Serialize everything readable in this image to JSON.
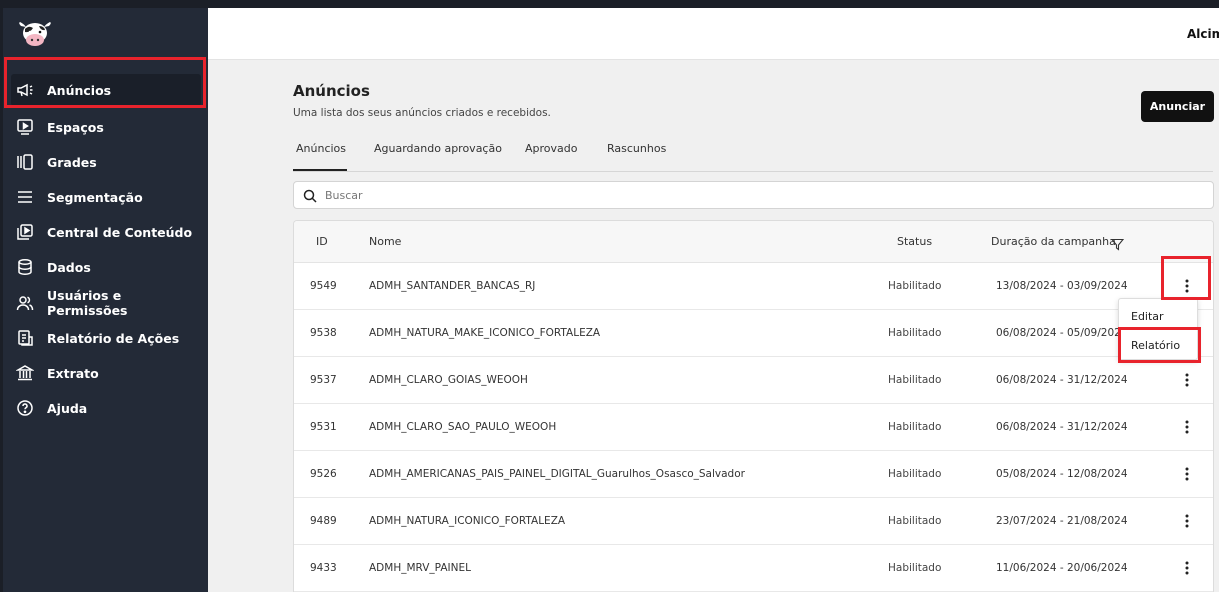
{
  "header": {
    "user_name": "Alcima"
  },
  "sidebar": {
    "items": [
      {
        "label": "Anúncios",
        "icon": "megaphone-icon"
      },
      {
        "label": "Espaços",
        "icon": "monitor-play-icon"
      },
      {
        "label": "Grades",
        "icon": "grid-columns-icon"
      },
      {
        "label": "Segmentação",
        "icon": "menu-lines-icon"
      },
      {
        "label": "Central de Conteúdo",
        "icon": "content-play-icon"
      },
      {
        "label": "Dados",
        "icon": "database-icon"
      },
      {
        "label": "Usuários e Permissões",
        "icon": "users-icon"
      },
      {
        "label": "Relatório de Ações",
        "icon": "report-icon"
      },
      {
        "label": "Extrato",
        "icon": "bank-icon"
      },
      {
        "label": "Ajuda",
        "icon": "help-circle-icon"
      }
    ]
  },
  "page": {
    "title": "Anúncios",
    "subtitle": "Uma lista dos seus anúncios criados e recebidos.",
    "primary_button": "Anunciar"
  },
  "tabs": [
    "Anúncios",
    "Aguardando aprovação",
    "Aprovado",
    "Rascunhos"
  ],
  "search": {
    "placeholder": "Buscar"
  },
  "table": {
    "columns": [
      "ID",
      "Nome",
      "Status",
      "Duração da campanha"
    ],
    "rows": [
      {
        "id": "9549",
        "name": "ADMH_SANTANDER_BANCAS_RJ",
        "status": "Habilitado",
        "period": "13/08/2024 - 03/09/2024"
      },
      {
        "id": "9538",
        "name": "ADMH_NATURA_MAKE_ICONICO_FORTALEZA",
        "status": "Habilitado",
        "period": "06/08/2024 - 05/09/2024"
      },
      {
        "id": "9537",
        "name": "ADMH_CLARO_GOIAS_WEOOH",
        "status": "Habilitado",
        "period": "06/08/2024 - 31/12/2024"
      },
      {
        "id": "9531",
        "name": "ADMH_CLARO_SAO_PAULO_WEOOH",
        "status": "Habilitado",
        "period": "06/08/2024 - 31/12/2024"
      },
      {
        "id": "9526",
        "name": "ADMH_AMERICANAS_PAIS_PAINEL_DIGITAL_Guarulhos_Osasco_Salvador",
        "status": "Habilitado",
        "period": "05/08/2024 - 12/08/2024"
      },
      {
        "id": "9489",
        "name": "ADMH_NATURA_ICONICO_FORTALEZA",
        "status": "Habilitado",
        "period": "23/07/2024 - 21/08/2024"
      },
      {
        "id": "9433",
        "name": "ADMH_MRV_PAINEL",
        "status": "Habilitado",
        "period": "11/06/2024 - 20/06/2024"
      }
    ]
  },
  "row_menu": {
    "items": [
      "Editar",
      "Relatório"
    ]
  },
  "colors": {
    "sidebar_bg": "#232a37",
    "highlight": "#e8232c",
    "primary_button": "#111111"
  }
}
